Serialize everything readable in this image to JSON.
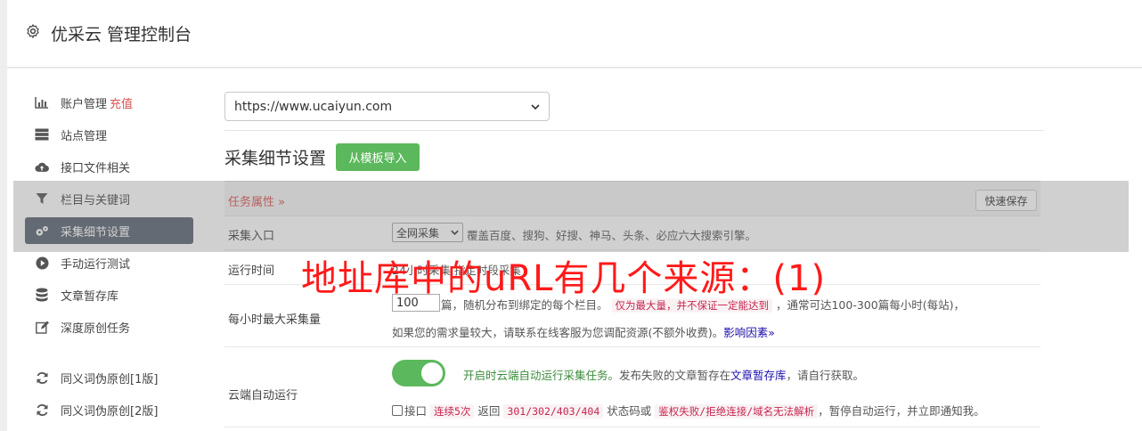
{
  "header": {
    "title": "优采云 管理控制台",
    "icon": "gear-icon"
  },
  "sidebar": {
    "items": [
      {
        "label": "账户管理",
        "badge": "充值",
        "icon": "bar-chart-icon"
      },
      {
        "label": "站点管理",
        "icon": "server-icon"
      },
      {
        "label": "接口文件相关",
        "icon": "cloud-upload-icon"
      },
      {
        "label": "栏目与关键词",
        "icon": "filter-icon"
      },
      {
        "label": "采集细节设置",
        "icon": "gears-icon",
        "active": true
      },
      {
        "label": "手动运行测试",
        "icon": "play-circle-icon"
      },
      {
        "label": "文章暂存库",
        "icon": "database-icon"
      },
      {
        "label": "深度原创任务",
        "icon": "edit-icon"
      },
      {
        "label": "同义词伪原创[1版]",
        "icon": "refresh-icon"
      },
      {
        "label": "同义词伪原创[2版]",
        "icon": "refresh-icon"
      }
    ]
  },
  "site_select": {
    "value": "https://www.ucaiyun.com"
  },
  "section": {
    "title": "采集细节设置",
    "import_button": "从模板导入"
  },
  "form": {
    "task_header": "任务属性 »",
    "save_button": "快速保存",
    "entry": {
      "label": "采集入口",
      "select_value": "全网采集",
      "note": "覆盖百度、搜狗、好搜、神马、头条、必应六大搜索引擎。"
    },
    "run_time": {
      "label": "运行时间",
      "visible_text": "24小时采集   指定时段采集"
    },
    "max_per_hour": {
      "label": "每小时最大采集量",
      "value": "100",
      "text1": "篇，随机分布到绑定的每个栏目。",
      "code1": "仅为最大量，并不保证一定能达到",
      "text2": "，通常可达100-300篇每小时(每站)，",
      "text3": "如果您的需求量较大，请联系在线客服为您调配资源(不额外收费)。",
      "link": "影响因素»"
    },
    "cloud": {
      "label": "云端自动运行",
      "toggle_on": true,
      "green_text": "开启时云端自动运行采集任务。",
      "text_a": "发布失败的文章暂存在",
      "link": "文章暂存库",
      "text_b": "，请自行获取。",
      "chk_label": "接口",
      "code1": "连续5次",
      "text_c": "返回",
      "code2": "301/302/403/404",
      "text_d": "状态码或",
      "code3": "鉴权失败/拒绝连接/域名无法解析",
      "text_e": "，暂停自动运行，并立即通知我。"
    }
  },
  "overlay": {
    "text": "地址库中的uRL有几个来源：(1)"
  }
}
